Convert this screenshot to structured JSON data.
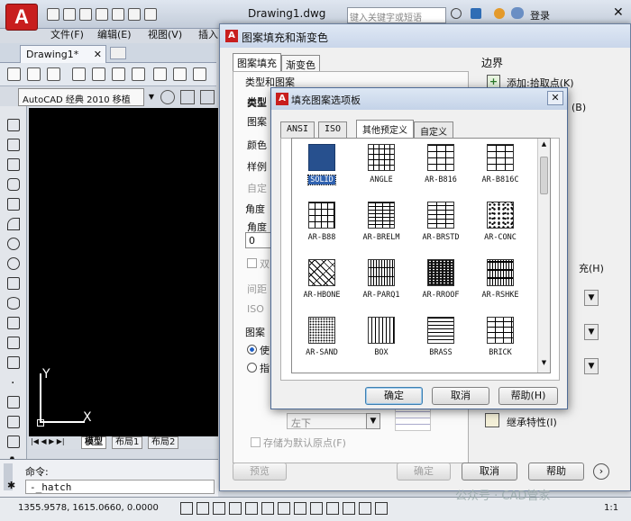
{
  "app": {
    "drawing_title": "Drawing1.dwg",
    "search_placeholder": "键入关键字或短语",
    "login_label": "登录",
    "menus": [
      "文件(F)",
      "编辑(E)",
      "视图(V)",
      "插入"
    ],
    "doc_tab": "Drawing1*",
    "workspace": "AutoCAD 经典",
    "workspace_extra": "2010 移植"
  },
  "canvas": {
    "axis_y": "Y",
    "axis_x": "X",
    "layout_tabs": [
      "模型",
      "布局1",
      "布局2"
    ]
  },
  "command": {
    "prompt": "命令:",
    "input": "-_hatch"
  },
  "status": {
    "coords": "1355.9578, 1615.0660, 0.0000",
    "zoom": "1:1"
  },
  "hatch_dialog": {
    "title": "图案填充和渐变色",
    "tabs": [
      "图案填充",
      "渐变色"
    ],
    "group_type_pattern": "类型和图案",
    "labels_left": [
      "类型",
      "类型",
      "图案",
      "颜色",
      "样例",
      "自定"
    ],
    "angle_group": "角度",
    "angle_label": "角度",
    "angle_value": "0",
    "checkbox_labels": [
      "双",
      "间距",
      "ISO"
    ],
    "origin_group": "图案",
    "origin_option1": "使",
    "origin_option2": "指",
    "origin_corner": "左下",
    "store_default": "存储为默认原点(F)",
    "boundary_title": "边界",
    "add_pick_point": "添加:拾取点(K)",
    "boundary_letter_b": "(B)",
    "fill_label": "充(H)",
    "inherit_label": "继承特性(I)",
    "preview_btn": "预览",
    "ok_btn": "确定",
    "cancel_btn": "取消",
    "help_btn": "帮助"
  },
  "palette": {
    "title": "填充图案选项板",
    "tabs": [
      "ANSI",
      "ISO",
      "其他预定义",
      "自定义"
    ],
    "patterns": [
      "SOLID",
      "ANGLE",
      "AR-B816",
      "AR-B816C",
      "AR-B88",
      "AR-BRELM",
      "AR-BRSTD",
      "AR-CONC",
      "AR-HBONE",
      "AR-PARQ1",
      "AR-RROOF",
      "AR-RSHKE",
      "AR-SAND",
      "BOX",
      "BRASS",
      "BRICK"
    ],
    "ok_btn": "确定",
    "cancel_btn": "取消",
    "help_btn": "帮助(H)"
  },
  "watermark": "公众号 · CAD管家"
}
